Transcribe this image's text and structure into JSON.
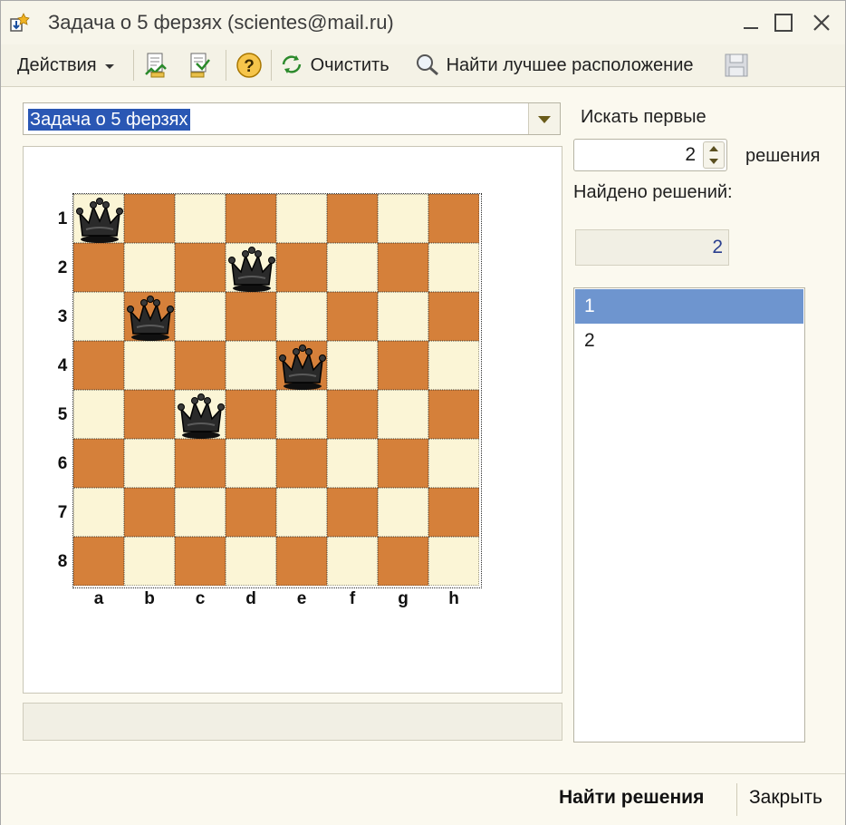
{
  "window": {
    "title": "Задача о 5 ферзях (scientes@mail.ru)"
  },
  "toolbar": {
    "actions_label": "Действия",
    "clear_label": "Очистить",
    "find_best_label": "Найти лучшее расположение"
  },
  "form": {
    "task_select_value": "Задача о 5 ферзях",
    "search_first_label": "Искать первые",
    "search_count": "2",
    "solutions_label": "решения",
    "found_label": "Найдено решений:",
    "found_count": "2"
  },
  "solutions": [
    "1",
    "2"
  ],
  "selected_solution": "1",
  "board": {
    "files": [
      "a",
      "b",
      "c",
      "d",
      "e",
      "f",
      "g",
      "h"
    ],
    "ranks": [
      "1",
      "2",
      "3",
      "4",
      "5",
      "6",
      "7",
      "8"
    ],
    "queens": [
      "a1",
      "d2",
      "b3",
      "e4",
      "c5"
    ],
    "light_color": "#fbf5d6",
    "dark_color": "#d5803a"
  },
  "footer": {
    "find_solutions_label": "Найти решения",
    "close_label": "Закрыть"
  }
}
